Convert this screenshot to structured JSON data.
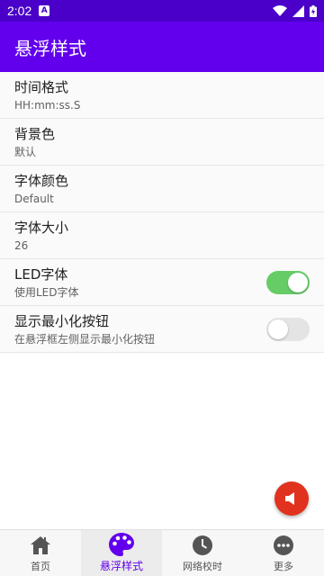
{
  "status_bar": {
    "time": "2:02",
    "notification_icon": "A"
  },
  "app_bar": {
    "title": "悬浮样式"
  },
  "settings": [
    {
      "title": "时间格式",
      "summary": "HH:mm:ss.S"
    },
    {
      "title": "背景色",
      "summary": "默认"
    },
    {
      "title": "字体颜色",
      "summary": "Default"
    },
    {
      "title": "字体大小",
      "summary": "26"
    },
    {
      "title": "LED字体",
      "summary": "使用LED字体",
      "toggle": true
    },
    {
      "title": "显示最小化按钮",
      "summary": "在悬浮框左侧显示最小化按钮",
      "toggle": false
    }
  ],
  "fab": {
    "icon": "speaker-icon"
  },
  "bottom_nav": [
    {
      "label": "首页",
      "icon": "home-icon"
    },
    {
      "label": "悬浮样式",
      "icon": "palette-icon",
      "active": true
    },
    {
      "label": "网络校时",
      "icon": "clock-icon"
    },
    {
      "label": "更多",
      "icon": "more-icon"
    }
  ],
  "colors": {
    "status_bar": "#4a00c8",
    "app_bar": "#6200ee",
    "toggle_on": "#66cc66",
    "fab": "#e0321e"
  }
}
